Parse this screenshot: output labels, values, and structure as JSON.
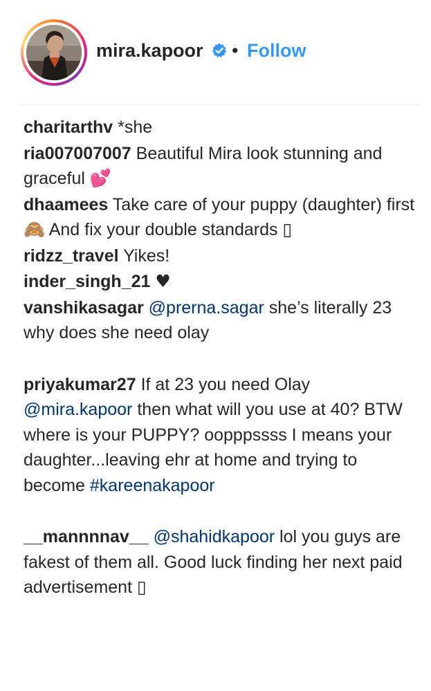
{
  "post_header": {
    "username": "mira.kapoor",
    "separator": "•",
    "follow_label": "Follow",
    "verified": true,
    "accent_color": "#3897f0",
    "avatar_ring_colors": [
      "#f58529",
      "#dd2a7b",
      "#8134af",
      "#feda77"
    ]
  },
  "comments": [
    {
      "user": "charitarthv",
      "text": "*she"
    },
    {
      "user": "ria007007007",
      "text": "Beautiful Mira look stunning and graceful",
      "emoji": "💕"
    },
    {
      "user": "dhaamees",
      "text_part1": "Take care of your puppy (daughter) first",
      "emoji1": "🙈",
      "text_part2": "And fix your double standards",
      "emoji2": "▯"
    },
    {
      "user": "ridzz_travel",
      "text": "Yikes!"
    },
    {
      "user": "inder_singh_21",
      "emoji": "♥"
    },
    {
      "user": "vanshikasagar",
      "mention": "@prerna.sagar",
      "text": "she’s literally 23 why does she need olay"
    },
    {
      "user": "priyakumar27",
      "text_part1": "If at 23 you need Olay",
      "mention": "@mira.kapoor",
      "text_part2": "then what will you use at 40? BTW where is your PUPPY? oopppssss I means your daughter...leaving ehr at home and trying to become",
      "hashtag": "#kareenakapoor"
    },
    {
      "user": "__mannnnav__",
      "mention": "@shahidkapoor",
      "text": "lol you guys are fakest of them all. Good luck finding her next paid advertisement",
      "emoji": "▯"
    }
  ]
}
